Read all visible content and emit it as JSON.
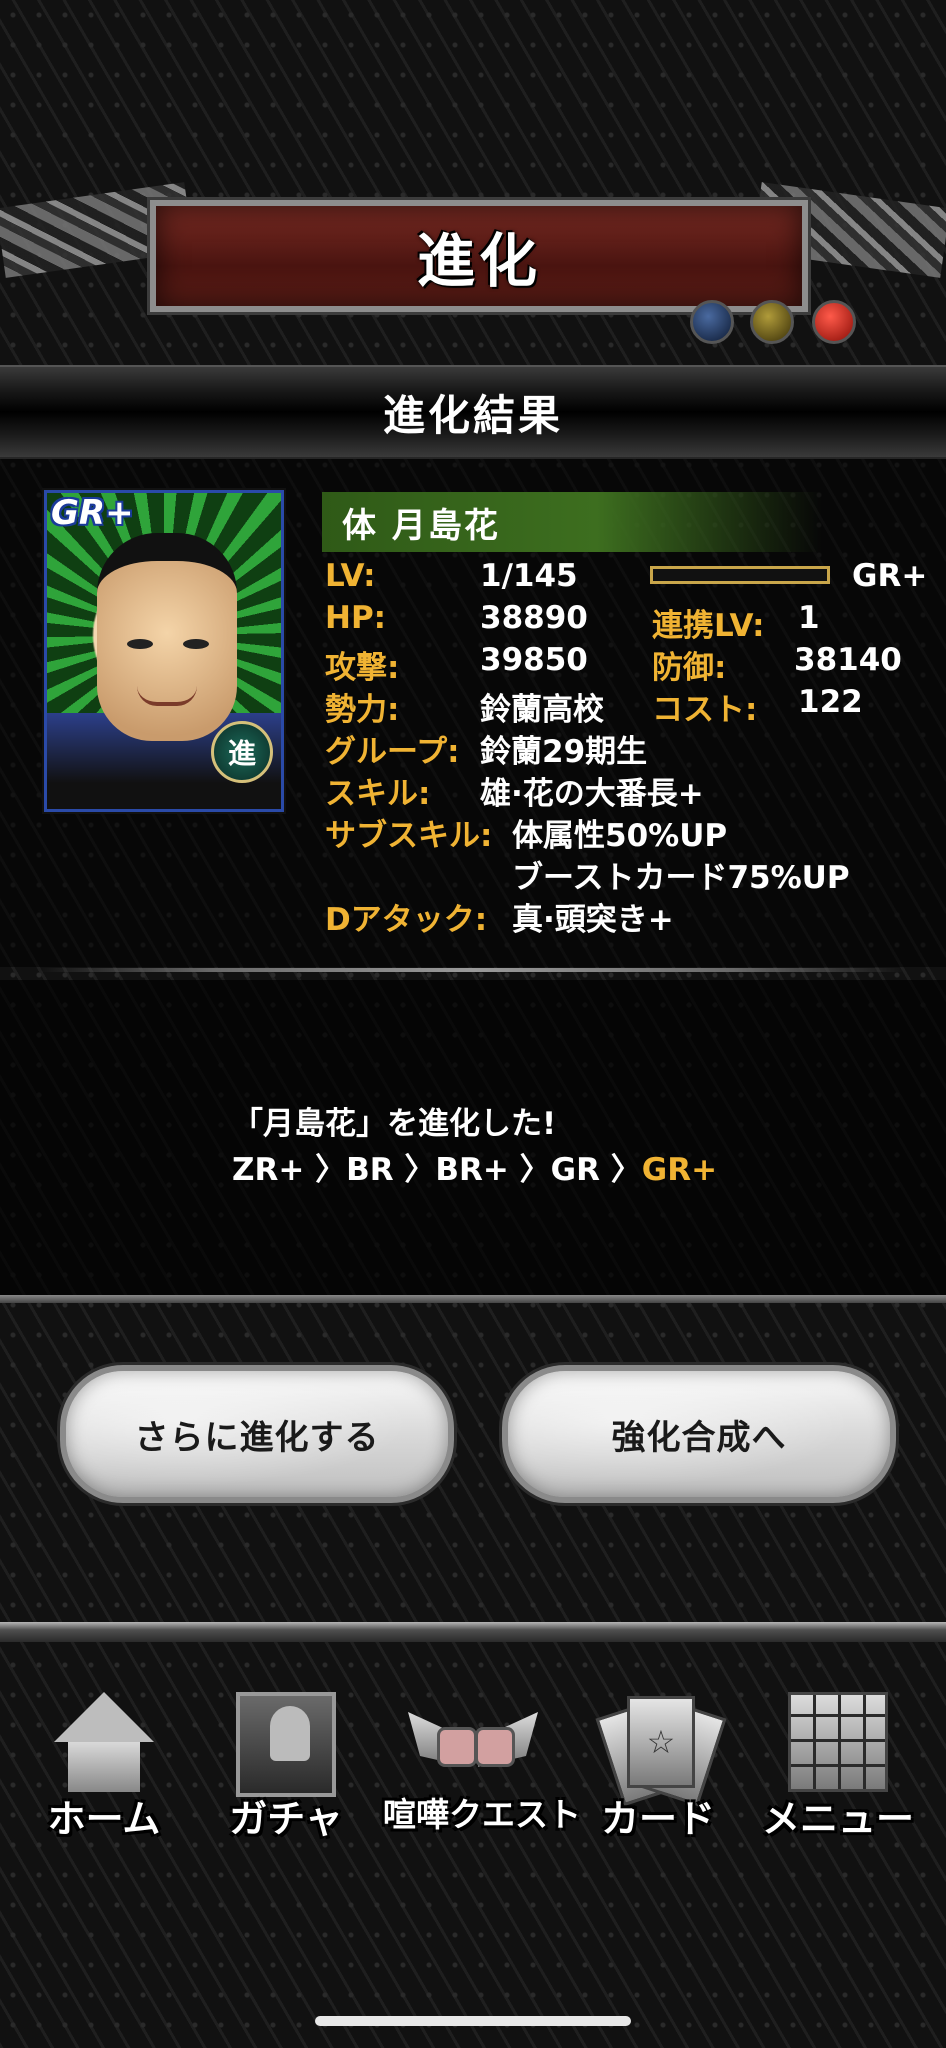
{
  "header": {
    "title": "進化"
  },
  "section": {
    "title": "進化結果"
  },
  "card": {
    "grade_badge": "GR+",
    "evo_badge": "進",
    "name": "体 月島花",
    "level_progress": 0,
    "stats": {
      "lv_label": "LV:",
      "lv_value": "1/145",
      "rarity": "GR+",
      "hp_label": "HP:",
      "hp_value": "38890",
      "link_lv_label": "連携LV:",
      "link_lv_value": "1",
      "attack_label": "攻撃:",
      "attack_value": "39850",
      "defense_label": "防御:",
      "defense_value": "38140",
      "faction_label": "勢力:",
      "faction_value": "鈴蘭高校",
      "cost_label": "コスト:",
      "cost_value": "122",
      "group_label": "グループ:",
      "group_value": "鈴蘭29期生",
      "skill_label": "スキル:",
      "skill_value": "雄·花の大番長+",
      "subskill_label": "サブスキル:",
      "subskill_value_1": "体属性50%UP",
      "subskill_value_2": "ブーストカード75%UP",
      "dattack_label": "Dアタック:",
      "dattack_value": "真·頭突き+"
    }
  },
  "result": {
    "message": "「月島花」を進化した!",
    "path_prefix": "ZR+ 〉BR 〉BR+ 〉GR 〉",
    "path_final": "GR+"
  },
  "buttons": {
    "evolve_more": "さらに進化する",
    "enhance": "強化合成へ"
  },
  "nav": {
    "home": "ホーム",
    "gacha": "ガチャ",
    "quest": "喧嘩クエスト",
    "card": "カード",
    "menu": "メニュー"
  },
  "colors": {
    "label_gold": "#f0b333",
    "title_red": "#5c1d16",
    "name_green": "#3d6e1f"
  }
}
